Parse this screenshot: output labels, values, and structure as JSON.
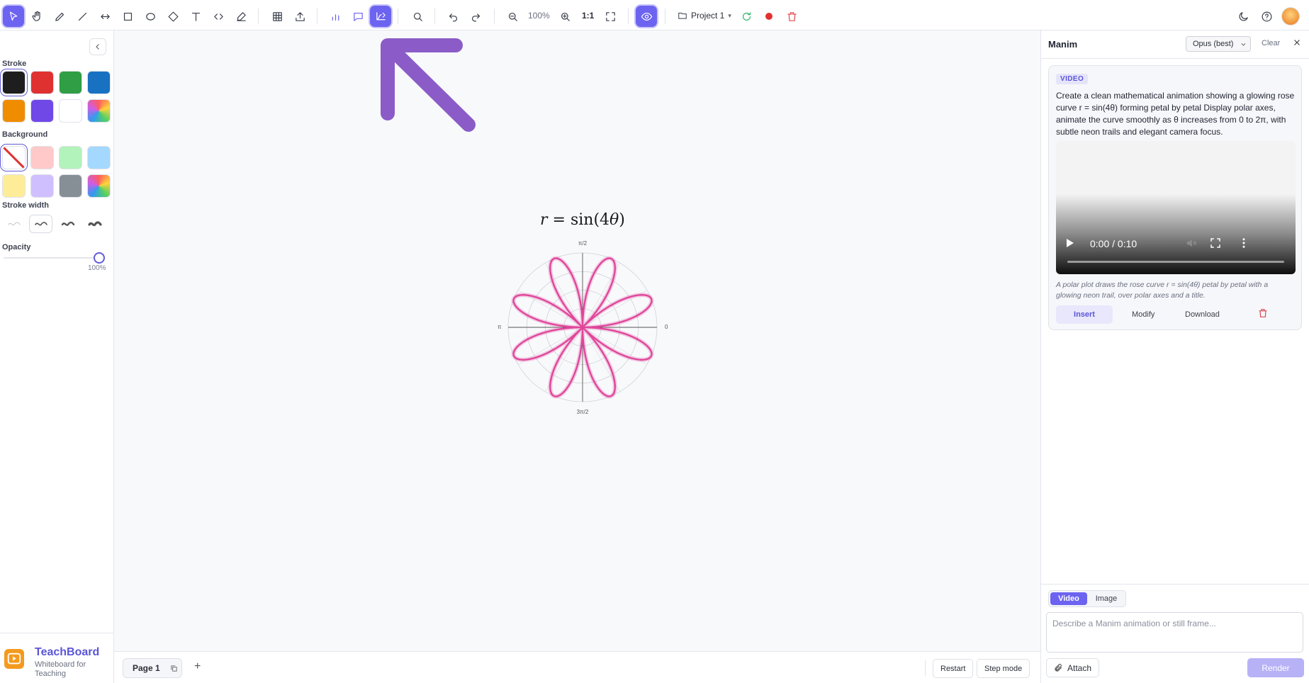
{
  "toolbar": {
    "zoom_level": "100%",
    "zoom_reset_label": "1:1",
    "project_label": "Project 1",
    "project_caret": "▾"
  },
  "left_panel": {
    "stroke_label": "Stroke",
    "background_label": "Background",
    "stroke_width_label": "Stroke width",
    "opacity_label": "Opacity",
    "opacity_value_text": "100%",
    "opacity_fraction": 1.0,
    "stroke_colors": [
      "#1e1e1e",
      "#e03131",
      "#2f9e44",
      "#1971c2",
      "#f08c00",
      "#7048e8",
      "#ffffff",
      "rainbow"
    ],
    "background_colors": [
      "transparent",
      "#ffc9c9",
      "#b2f2bb",
      "#a5d8ff",
      "#ffec99",
      "#d0bfff",
      "#868e96",
      "rainbow"
    ],
    "selected_stroke_index": 0,
    "selected_background_index": 0,
    "selected_stroke_width_index": 1
  },
  "brand": {
    "name": "TeachBoard",
    "tagline": "Whiteboard for Teaching"
  },
  "canvas": {
    "formula_r": "r",
    "formula_rest": "= sin(4",
    "formula_theta": "θ",
    "formula_close": ")",
    "arrow_color": "#8b5cc7",
    "curve_color": "#e0469b",
    "axis_labels": {
      "top": "π/2",
      "bottom": "3π/2",
      "left": "π",
      "right": "0"
    }
  },
  "bottom_bar": {
    "page_label": "Page 1",
    "add_page": "+",
    "restart_label": "Restart",
    "step_mode_label": "Step mode"
  },
  "right_panel": {
    "title": "Manim",
    "model_select": "Opus (best)",
    "clear_label": "Clear",
    "card": {
      "badge": "VIDEO",
      "prompt": "Create a clean mathematical animation showing a glowing rose curve r = sin(4θ) forming petal by petal Display polar axes, animate the curve smoothly as θ increases from 0 to 2π, with subtle neon trails and elegant camera focus.",
      "video_time": "0:00 / 0:10",
      "caption": "A polar plot draws the rose curve r = sin(4θ) petal by petal with a glowing neon trail, over polar axes and a title.",
      "insert_label": "Insert",
      "modify_label": "Modify",
      "download_label": "Download"
    },
    "mode_tabs": [
      "Video",
      "Image"
    ],
    "active_mode": "Video",
    "input_placeholder": "Describe a Manim animation or still frame...",
    "attach_label": "Attach",
    "render_label": "Render"
  },
  "colors": {
    "accent": "#6c63f0",
    "record": "#e03131",
    "refresh": "#2fb36a",
    "delete": "#e0474c"
  }
}
